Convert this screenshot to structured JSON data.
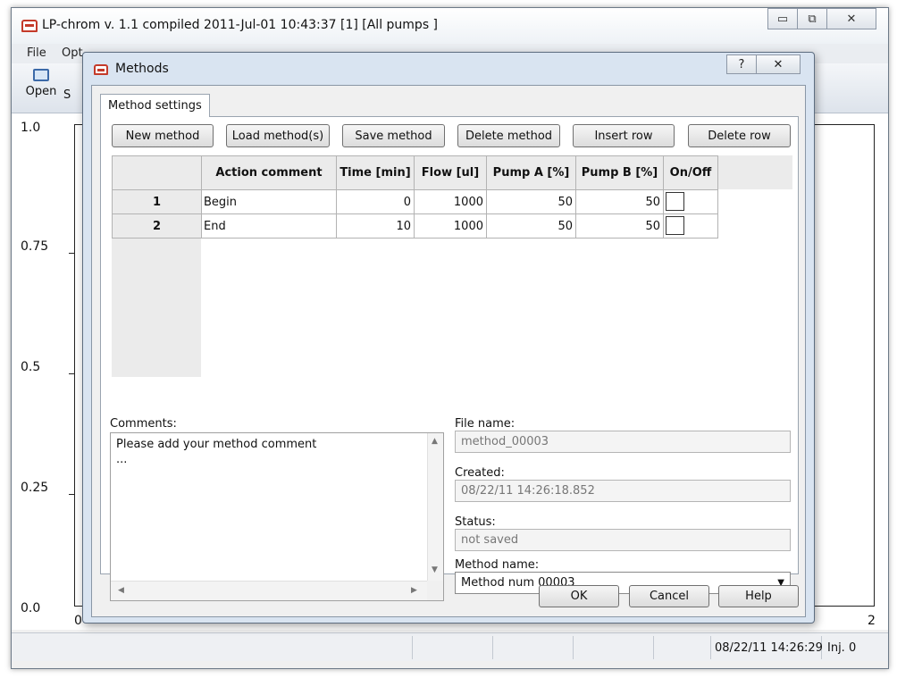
{
  "main_window": {
    "title": "LP-chrom v. 1.1 compiled 2011-Jul-01 10:43:37 [1] [All pumps ]",
    "caption_minimize": "▭",
    "caption_restore": "⧉",
    "caption_close": "✕",
    "menu": [
      "File",
      "Opt"
    ],
    "toolbar": {
      "open_label": "Open",
      "second_label": "S"
    },
    "chart": {
      "y_ticks": [
        "1.0",
        "0.75",
        "0.5",
        "0.25",
        "0.0"
      ],
      "x_ticks": [
        "0",
        "2"
      ]
    },
    "status": {
      "datetime": "08/22/11 14:26:29",
      "injection": "Inj. 0"
    }
  },
  "dialog": {
    "title": "Methods",
    "help_button": "?",
    "close_button": "✕",
    "tab_label": "Method settings",
    "buttons": {
      "new_method": "New method",
      "load_methods": "Load method(s)",
      "save_method": "Save method",
      "delete_method": "Delete method",
      "insert_row": "Insert row",
      "delete_row": "Delete row"
    },
    "grid": {
      "headers": [
        "Action comment",
        "Time [min]",
        "Flow [ul]",
        "Pump A [%]",
        "Pump B [%]",
        "On/Off"
      ],
      "rows": [
        {
          "num": "1",
          "comment": "Begin",
          "time": "0",
          "flow": "1000",
          "pump_a": "50",
          "pump_b": "50",
          "on": false
        },
        {
          "num": "2",
          "comment": "End",
          "time": "10",
          "flow": "1000",
          "pump_a": "50",
          "pump_b": "50",
          "on": false
        }
      ]
    },
    "comments": {
      "label": "Comments:",
      "text": "Please add your method comment\n..."
    },
    "file_name": {
      "label": "File name:",
      "value": "method_00003"
    },
    "created": {
      "label": "Created:",
      "value": "08/22/11 14:26:18.852"
    },
    "status": {
      "label": "Status:",
      "value": "not saved"
    },
    "method_name": {
      "label": "Method name:",
      "value": "Method num 00003"
    },
    "footer": {
      "ok": "OK",
      "cancel": "Cancel",
      "help": "Help"
    }
  }
}
